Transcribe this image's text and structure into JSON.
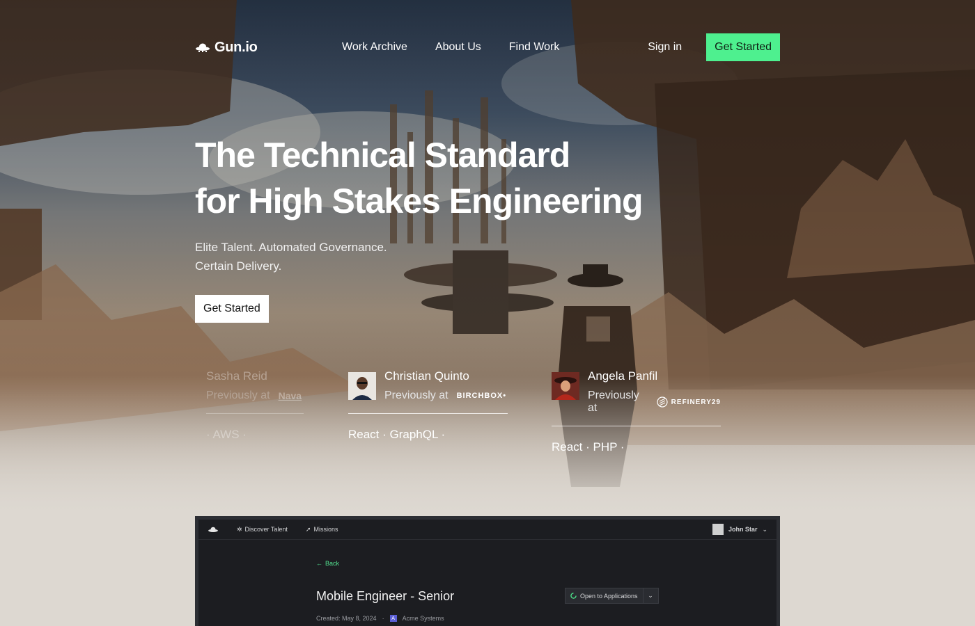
{
  "brand": {
    "name": "Gun.io"
  },
  "nav": {
    "links": [
      "Work Archive",
      "About Us",
      "Find Work"
    ],
    "signin": "Sign in",
    "cta": "Get Started"
  },
  "hero": {
    "title_line1": "The Technical Standard",
    "title_line2": "for High Stakes Engineering",
    "sub_line1": "Elite Talent. Automated Governance.",
    "sub_line2": "Certain Delivery.",
    "cta": "Get Started"
  },
  "talents": [
    {
      "name": "Sasha Reid",
      "previously": "Previously at",
      "company": "Nava",
      "skills": "· AWS ·"
    },
    {
      "name": "Christian Quinto",
      "previously": "Previously at",
      "company": "BIRCHBOX•",
      "skills": "React · GraphQL ·"
    },
    {
      "name": "Angela Panfil",
      "previously": "Previously at",
      "company": "REFINERY29",
      "skills": "React · PHP ·"
    }
  ],
  "preview": {
    "tabs": [
      "Discover Talent",
      "Missions"
    ],
    "user": "John Star",
    "back": "Back",
    "title": "Mobile Engineer - Senior",
    "created": "Created: May 8, 2024",
    "company": "Acme Systems",
    "company_badge": "A",
    "status": "Open to Applications"
  },
  "colors": {
    "accent": "#4ef08f",
    "preview_bg": "#1c1d21"
  }
}
